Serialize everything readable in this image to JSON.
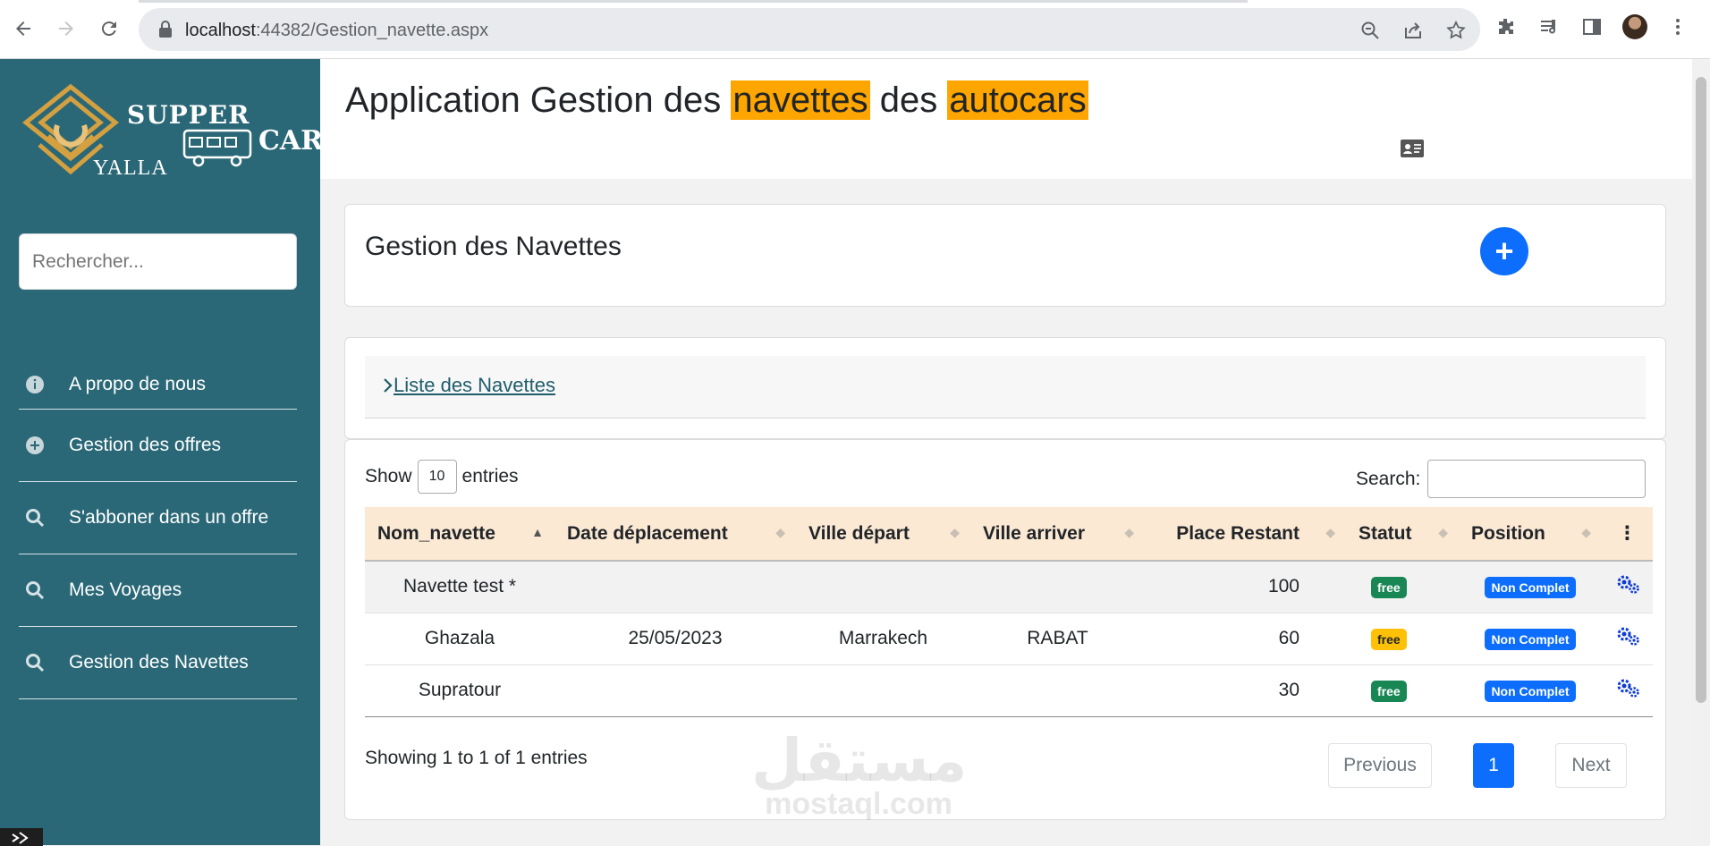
{
  "browser": {
    "url_host": "localhost",
    "url_rest": ":44382/Gestion_navette.aspx"
  },
  "sidebar": {
    "logo": {
      "supper": "SUPPER",
      "car": "CAR",
      "yalla": "YALLA"
    },
    "search_placeholder": "Rechercher...",
    "items": [
      {
        "label": "A propo de nous",
        "icon": "info-icon"
      },
      {
        "label": "Gestion des offres",
        "icon": "plus-circle-icon"
      },
      {
        "label": "S'abboner dans un offre",
        "icon": "search-icon"
      },
      {
        "label": "Mes Voyages",
        "icon": "search-icon"
      },
      {
        "label": "Gestion des Navettes",
        "icon": "search-icon"
      }
    ]
  },
  "header": {
    "title_part1": "Application Gestion des ",
    "title_hl1": "navettes",
    "title_part2": " des ",
    "title_hl2": "autocars"
  },
  "gestion_card": {
    "title": "Gestion des Navettes",
    "add_label": "+"
  },
  "list_card": {
    "link": "Liste des Navettes"
  },
  "datatable": {
    "show_label": "Show",
    "length_value": "10",
    "entries_label": "entries",
    "search_label": "Search:",
    "columns": [
      "Nom_navette",
      "Date déplacement",
      "Ville départ",
      "Ville arriver",
      "Place Restant",
      "Statut",
      "Position",
      "⋮"
    ],
    "rows": [
      {
        "nom": "Navette test *",
        "date": "",
        "depart": "",
        "arriver": "",
        "places": "100",
        "statut": "free",
        "statut_color": "green",
        "position": "Non Complet"
      },
      {
        "nom": "Ghazala",
        "date": "25/05/2023",
        "depart": "Marrakech",
        "arriver": "RABAT",
        "places": "60",
        "statut": "free",
        "statut_color": "yellow",
        "position": "Non Complet"
      },
      {
        "nom": "Supratour",
        "date": "",
        "depart": "",
        "arriver": "",
        "places": "30",
        "statut": "free",
        "statut_color": "green",
        "position": "Non Complet"
      }
    ],
    "info": "Showing 1 to 1 of 1 entries",
    "prev": "Previous",
    "page": "1",
    "next": "Next"
  },
  "watermark": {
    "arabic": "مستقل",
    "latin": "mostaql.com"
  },
  "colors": {
    "sidebar": "#2b6877",
    "highlight": "#ffa500",
    "primary": "#0d6efd",
    "table_head": "#fbe9d4"
  }
}
